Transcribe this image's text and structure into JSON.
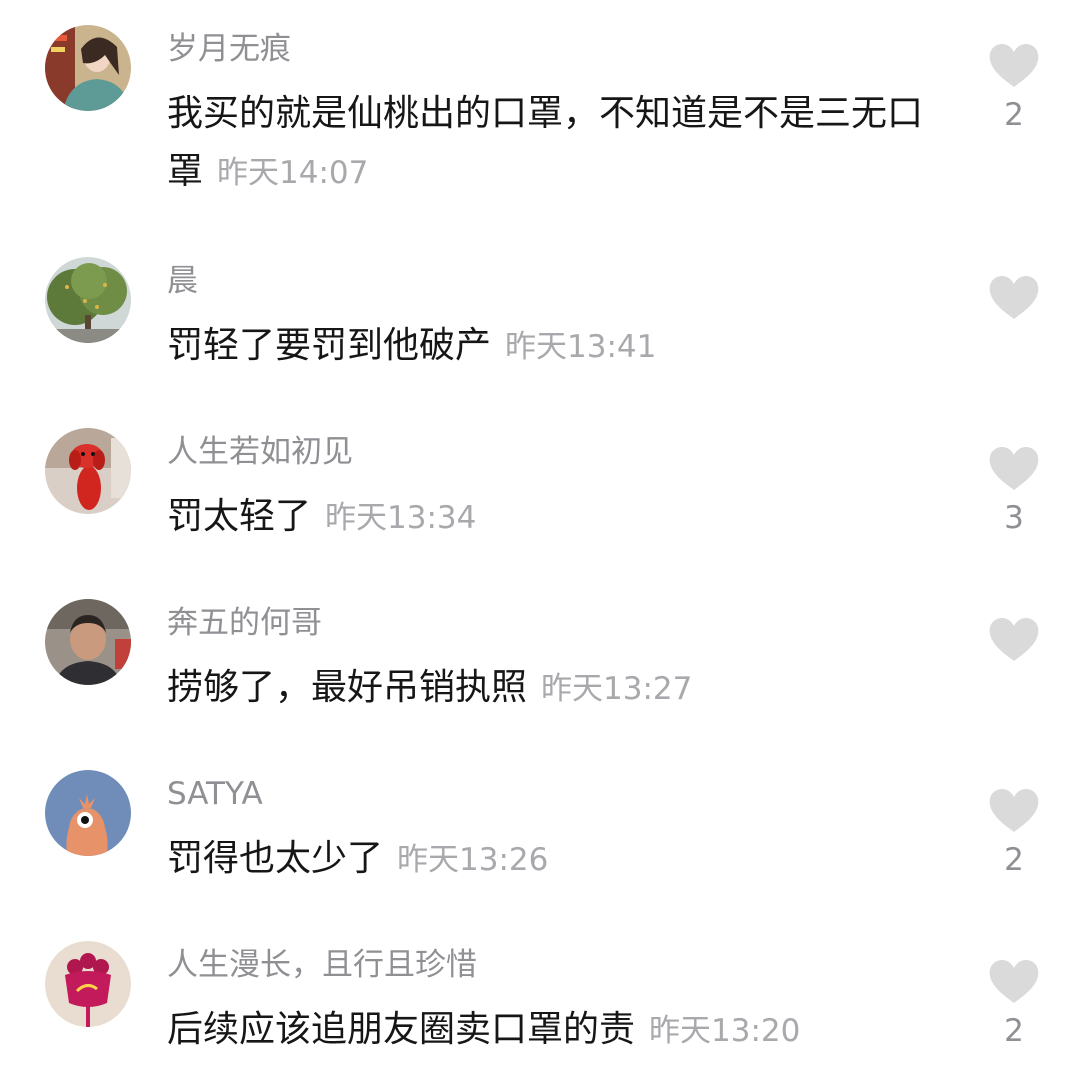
{
  "comments": [
    {
      "username": "岁月无痕",
      "text": "我买的就是仙桃出的口罩，不知道是不是三无口罩",
      "time": "昨天14:07",
      "likes": "2",
      "avatar": "woman-portrait-avatar"
    },
    {
      "username": "晨",
      "text": "罚轻了要罚到他破产",
      "time": "昨天13:41",
      "likes": "",
      "avatar": "tree-photo-avatar"
    },
    {
      "username": "人生若如初见",
      "text": "罚太轻了",
      "time": "昨天13:34",
      "likes": "3",
      "avatar": "red-dog-statue-avatar"
    },
    {
      "username": "奔五的何哥",
      "text": "捞够了，最好吊销执照",
      "time": "昨天13:27",
      "likes": "",
      "avatar": "man-portrait-avatar"
    },
    {
      "username": "SATYA",
      "text": "罚得也太少了",
      "time": "昨天13:26",
      "likes": "2",
      "avatar": "cartoon-bird-avatar"
    },
    {
      "username": "人生漫长，且行且珍惜",
      "text": "后续应该追朋友圈卖口罩的责",
      "time": "昨天13:20",
      "likes": "2",
      "avatar": "flower-illustration-avatar"
    }
  ],
  "colors": {
    "username": "#8f8f94",
    "text": "#161616",
    "timestamp": "#a9a9ad",
    "heart": "#dadada",
    "background": "#ffffff"
  },
  "icons": {
    "like": "heart-icon"
  }
}
